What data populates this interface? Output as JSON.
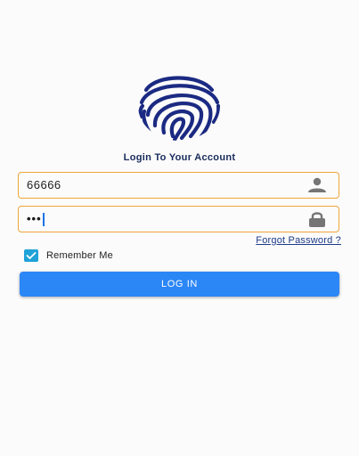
{
  "login": {
    "title": "Login To Your Account",
    "username_value": "66666",
    "password_masked": "•••",
    "remember_label": "Remember Me",
    "remember_checked": true,
    "forgot_label": "Forgot Password ?",
    "login_button_label": "LOG IN"
  },
  "icons": {
    "logo": "fingerprint-icon",
    "username": "person-icon",
    "password": "lock-icon",
    "remember": "checkmark-icon"
  },
  "colors": {
    "logo": "#1b2a82",
    "title": "#172a5a",
    "field_border": "#f0a53a",
    "caret": "#1a73e8",
    "checkbox": "#1fa2d8",
    "forgot_link": "#1e3b8a",
    "button": "#2b86f6",
    "field_icon": "#757575"
  }
}
